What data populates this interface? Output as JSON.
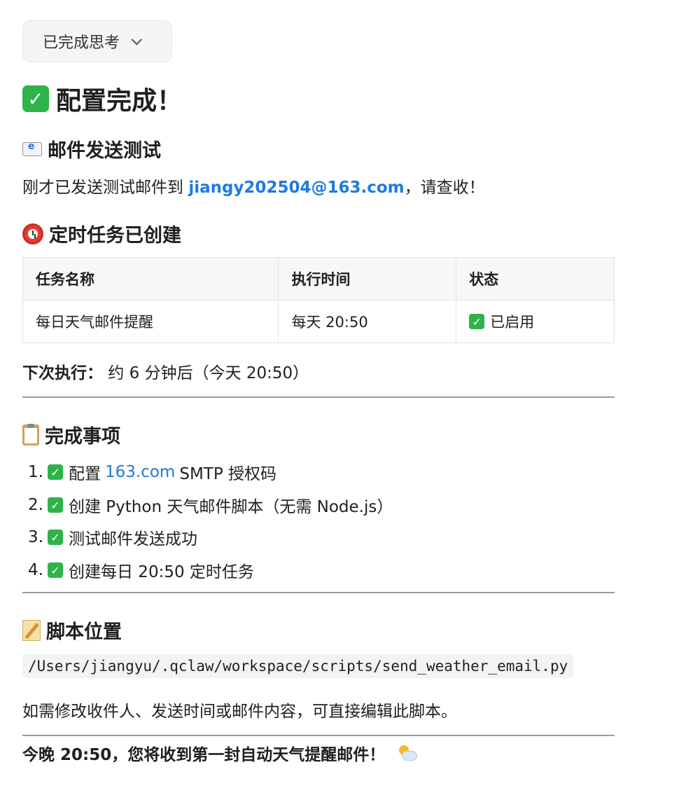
{
  "thinking": {
    "label": "已完成思考"
  },
  "title": "配置完成！",
  "email_section": {
    "heading": "邮件发送测试",
    "text_before": "刚才已发送测试邮件到 ",
    "email": "jiangy202504@163.com",
    "text_after": "，请查收！"
  },
  "task_section": {
    "heading": "定时任务已创建",
    "columns": [
      "任务名称",
      "执行时间",
      "状态"
    ],
    "rows": [
      {
        "name": "每日天气邮件提醒",
        "time": "每天 20:50",
        "status": "已启用"
      }
    ],
    "next_label": "下次执行：",
    "next_value": " 约 6 分钟后（今天 20:50）"
  },
  "done_section": {
    "heading": "完成事项",
    "items": [
      {
        "num": "1.",
        "prefix": "配置 ",
        "link": "163.com",
        "suffix": " SMTP 授权码"
      },
      {
        "num": "2.",
        "text": "创建 Python 天气邮件脚本（无需 Node.js）"
      },
      {
        "num": "3.",
        "text": "测试邮件发送成功"
      },
      {
        "num": "4.",
        "text": "创建每日 20:50 定时任务"
      }
    ]
  },
  "script_section": {
    "heading": "脚本位置",
    "path": "/Users/jiangyu/.qclaw/workspace/scripts/send_weather_email.py",
    "note": "如需修改收件人、发送时间或邮件内容，可直接编辑此脚本。"
  },
  "footer": {
    "text": "今晚 20:50，您将收到第一封自动天气提醒邮件！"
  },
  "colors": {
    "accent": "#1f7ae0",
    "check": "#2db34a"
  },
  "icons": [
    "check-icon",
    "envelope-icon",
    "alarm-clock-icon",
    "clipboard-icon",
    "memo-icon",
    "sun-cloud-icon",
    "chevron-down-icon"
  ]
}
